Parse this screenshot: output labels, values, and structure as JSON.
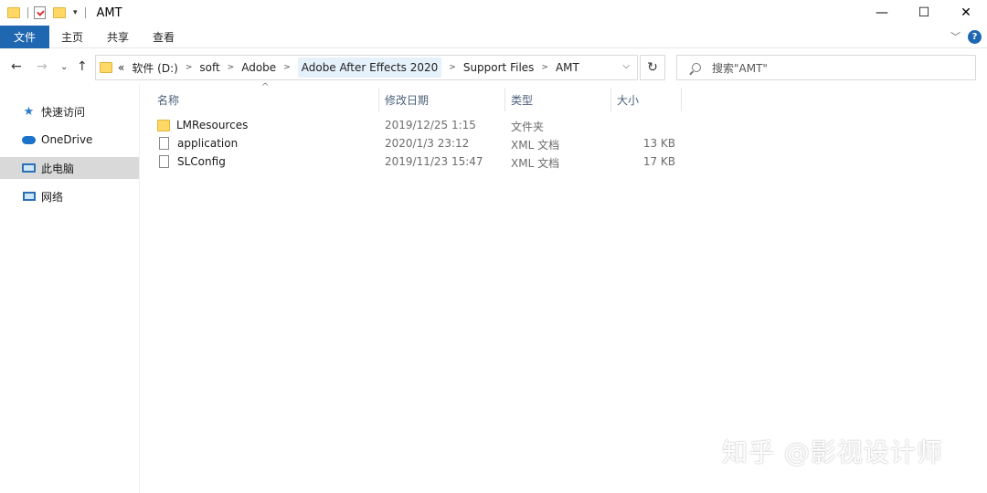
{
  "window": {
    "title": "AMT",
    "minimize_glyph": "—",
    "maximize_glyph": "☐",
    "close_glyph": "✕"
  },
  "ribbon": {
    "tabs": [
      "文件",
      "主页",
      "共享",
      "查看"
    ],
    "help_glyph": "?"
  },
  "address": {
    "overflow": "«",
    "crumbs": [
      "软件 (D:)",
      "soft",
      "Adobe",
      "Adobe After Effects 2020",
      "Support Files",
      "AMT"
    ]
  },
  "search": {
    "placeholder": "搜索\"AMT\""
  },
  "sidebar": {
    "items": [
      {
        "label": "快速访问",
        "icon": "star-icon"
      },
      {
        "label": "OneDrive",
        "icon": "cloud-icon"
      },
      {
        "label": "此电脑",
        "icon": "computer-icon"
      },
      {
        "label": "网络",
        "icon": "network-icon"
      }
    ]
  },
  "columns": [
    "名称",
    "修改日期",
    "类型",
    "大小"
  ],
  "files": [
    {
      "name": "LMResources",
      "date": "2019/12/25 1:15",
      "type": "文件夹",
      "size": "",
      "icon": "folder"
    },
    {
      "name": "application",
      "date": "2020/1/3 23:12",
      "type": "XML 文档",
      "size": "13 KB",
      "icon": "doc"
    },
    {
      "name": "SLConfig",
      "date": "2019/11/23 15:47",
      "type": "XML 文档",
      "size": "17 KB",
      "icon": "doc"
    }
  ],
  "watermark": "知乎 @影视设计师",
  "colors": {
    "accent": "#1f67b1",
    "folder": "#ffd865"
  }
}
